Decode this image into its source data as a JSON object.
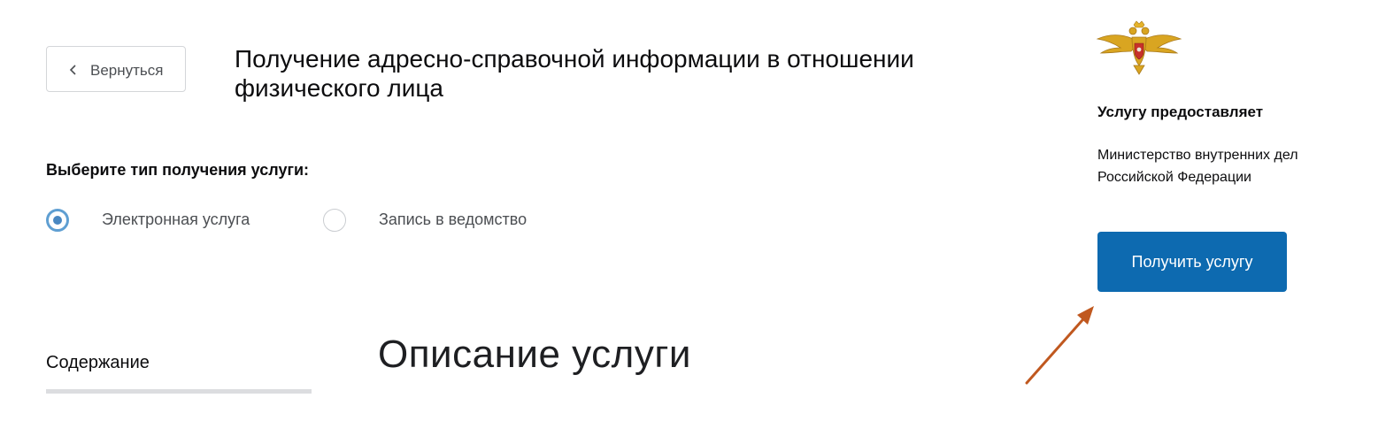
{
  "header": {
    "back_label": "Вернуться",
    "title": "Получение адресно-справочной информации в отношении физического лица"
  },
  "service_type": {
    "heading": "Выберите тип получения услуги:",
    "options": [
      {
        "label": "Электронная услуга",
        "selected": true
      },
      {
        "label": "Запись в ведомство",
        "selected": false
      }
    ]
  },
  "contents": {
    "label": "Содержание"
  },
  "description": {
    "heading": "Описание услуги"
  },
  "provider": {
    "emblem_icon": "russian-double-headed-eagle-emblem",
    "heading": "Услугу предоставляет",
    "name": "Министерство внутренних дел Российской Федерации"
  },
  "action": {
    "button_label": "Получить услугу"
  },
  "annotation": {
    "arrow_icon": "annotation-arrow-icon",
    "arrow_color": "#c0581f"
  },
  "colors": {
    "primary_button": "#0d6ab0",
    "radio_accent": "#4a88c2",
    "text": "#0c0c0e",
    "muted_text": "#4c4f53"
  }
}
